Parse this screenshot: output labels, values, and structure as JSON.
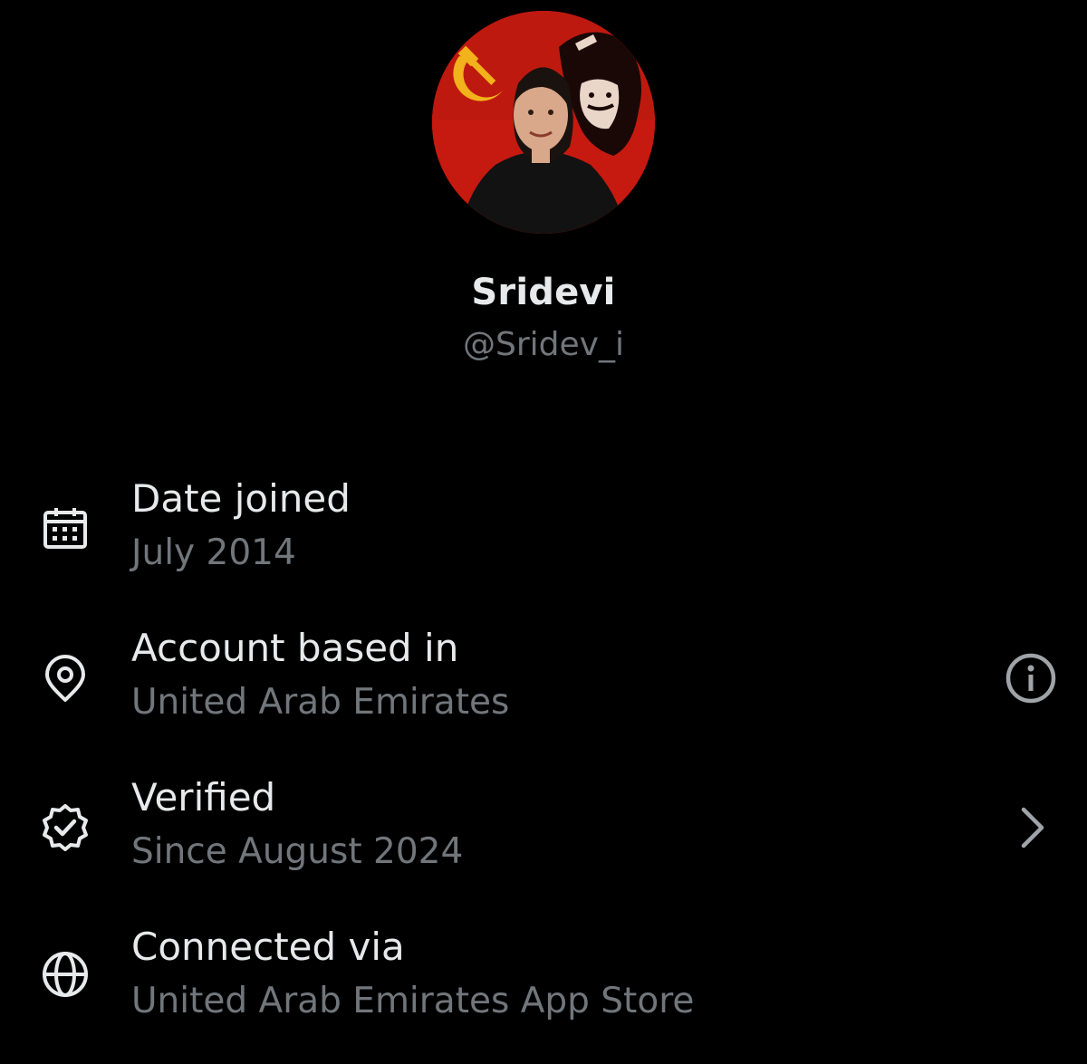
{
  "profile": {
    "display_name": "Sridevi",
    "handle": "@Sridev_i",
    "avatar_icon": "profile-photo"
  },
  "about": {
    "rows": [
      {
        "icon": "calendar-icon",
        "label": "Date joined",
        "value": "July 2014",
        "action_icon": null
      },
      {
        "icon": "location-pin-icon",
        "label": "Account based in",
        "value": "United Arab Emirates",
        "action_icon": "info-icon"
      },
      {
        "icon": "verified-badge-icon",
        "label": "Verified",
        "value": "Since August 2024",
        "action_icon": "chevron-right-icon"
      },
      {
        "icon": "globe-icon",
        "label": "Connected via",
        "value": "United Arab Emirates App Store",
        "action_icon": null
      }
    ]
  },
  "colors": {
    "background": "#000000",
    "primary_text": "#e7e9ea",
    "secondary_text": "#71767b",
    "avatar_background": "#c61a10"
  }
}
